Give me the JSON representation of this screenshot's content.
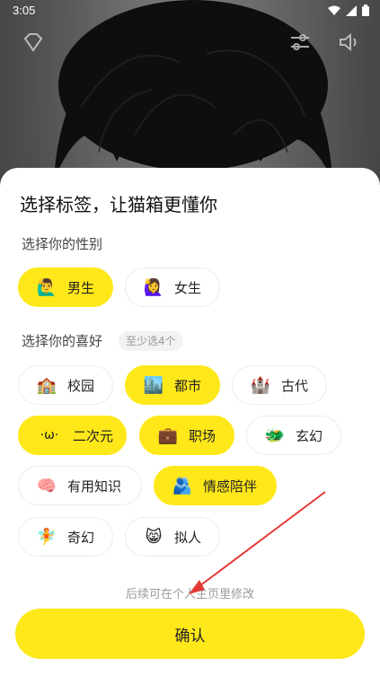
{
  "status_bar": {
    "time": "3:05"
  },
  "sheet": {
    "title": "选择标签，让猫箱更懂你",
    "gender_section": {
      "label": "选择你的性别",
      "options": [
        {
          "emoji": "🙋‍♂️",
          "label": "男生",
          "selected": true
        },
        {
          "emoji": "🙋‍♀️",
          "label": "女生",
          "selected": false
        }
      ]
    },
    "hobby_section": {
      "label": "选择你的喜好",
      "hint": "至少选4个",
      "options": [
        {
          "emoji": "🏫",
          "label": "校园",
          "selected": false
        },
        {
          "emoji": "🏙️",
          "label": "都市",
          "selected": true
        },
        {
          "emoji": "🏰",
          "label": "古代",
          "selected": false
        },
        {
          "emoji": "·ω·",
          "label": "二次元",
          "selected": true
        },
        {
          "emoji": "💼",
          "label": "职场",
          "selected": true
        },
        {
          "emoji": "🐲",
          "label": "玄幻",
          "selected": false
        },
        {
          "emoji": "🧠",
          "label": "有用知识",
          "selected": false
        },
        {
          "emoji": "🫂",
          "label": "情感陪伴",
          "selected": true
        },
        {
          "emoji": "🧚",
          "label": "奇幻",
          "selected": false
        },
        {
          "emoji": "😸",
          "label": "拟人",
          "selected": false
        }
      ]
    },
    "footer_note": "后续可在个人主页里修改",
    "confirm_label": "确认"
  },
  "colors": {
    "accent": "#FFE81A",
    "annotation_arrow": "#E53935"
  },
  "icons": [
    "diamond-icon",
    "settings-sliders-icon",
    "speaker-icon",
    "wifi-icon",
    "signal-icon",
    "battery-icon"
  ]
}
